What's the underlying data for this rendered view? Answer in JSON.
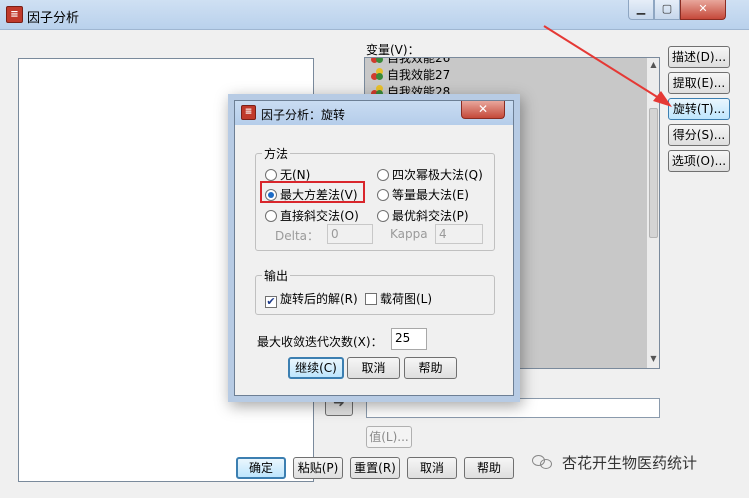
{
  "main_window": {
    "title": "因子分析",
    "variables_label": "变量(V)：",
    "variables_list": [
      "自我效能26",
      "自我效能27",
      "自我效能28"
    ],
    "side_buttons": [
      "描述(D)...",
      "提取(E)...",
      "旋转(T)...",
      "得分(S)...",
      "选项(O)..."
    ],
    "value_button": "值(L)...",
    "bottom_buttons": [
      "确定",
      "粘贴(P)",
      "重置(R)",
      "取消",
      "帮助"
    ],
    "min_icon": "minimize-icon",
    "max_icon": "maximize-icon",
    "close_label": "✕"
  },
  "dialog": {
    "title": "因子分析：旋转",
    "close_label": "✕",
    "method_group": "方法",
    "methods": {
      "none": "无(N)",
      "quartimax": "四次幂极大法(Q)",
      "varimax": "最大方差法(V)",
      "equamax": "等量最大法(E)",
      "oblimin": "直接斜交法(O)",
      "promax": "最优斜交法(P)"
    },
    "selected_method": "varimax",
    "delta_label": "Delta：",
    "delta_value": "0",
    "kappa_label": "Kappa",
    "kappa_value": "4",
    "output_group": "输出",
    "rotated_solution": "旋转后的解(R)",
    "rotated_solution_checked": true,
    "loading_plot": "载荷图(L)",
    "loading_plot_checked": false,
    "max_iter_label": "最大收敛迭代次数(X)：",
    "max_iter_value": "25",
    "buttons": {
      "continue": "继续(C)",
      "cancel": "取消",
      "help": "帮助"
    }
  },
  "watermark": "杏花开生物医药统计",
  "colors": {
    "highlight": "#d9262c",
    "arrow": "#e53935",
    "titlebar": "#b9d1ec"
  }
}
